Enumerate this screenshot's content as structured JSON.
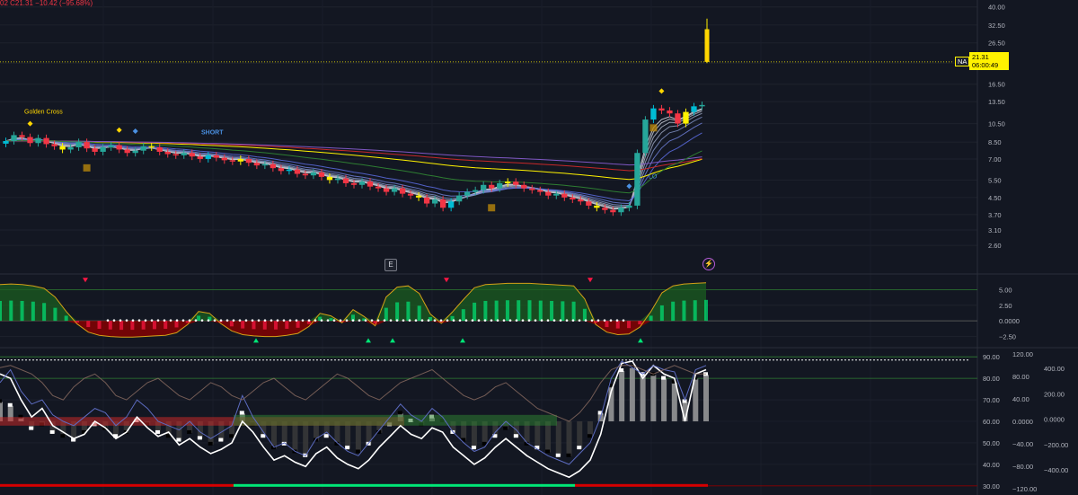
{
  "header": {
    "ohlc_text": "02  C21.31  −10.42 (−95.68%)"
  },
  "price_tag": {
    "symbol": "NA",
    "price": "21.31",
    "countdown": "06:00:49"
  },
  "buttons": {
    "e_label": "E",
    "alert_label": "⚡"
  },
  "colors": {
    "background": "#131722",
    "bull": "#26a69a",
    "bull_alt": "#00bcd4",
    "bear": "#f23645",
    "highlight": "#fff200",
    "grid": "#1e222d",
    "axis_text": "#b2b5be",
    "osc_green": "#00c853",
    "osc_red": "#c62828"
  },
  "chart_data": [
    {
      "type": "candlestick",
      "pane": "price",
      "ytick_labels": [
        "40.00",
        "32.50",
        "26.50",
        "21.00",
        "16.50",
        "13.50",
        "10.50",
        "8.50",
        "7.00",
        "5.50",
        "4.50",
        "3.70",
        "3.10",
        "2.60"
      ],
      "ytick_values": [
        40,
        32.5,
        26.5,
        21,
        16.5,
        13.5,
        10.5,
        8.5,
        7.0,
        5.5,
        4.5,
        3.7,
        3.1,
        2.6
      ],
      "scale": "log",
      "ylim": [
        2.3,
        42
      ],
      "annotations": [
        "Golden Cross",
        "SHORT",
        "LO"
      ],
      "last_price": 21.31,
      "closes": [
        8.6,
        9.2,
        9.0,
        8.4,
        8.9,
        8.3,
        8.1,
        7.8,
        8.0,
        8.5,
        7.9,
        7.6,
        8.0,
        8.2,
        7.8,
        7.5,
        7.7,
        8.1,
        8.0,
        7.6,
        7.4,
        7.3,
        7.5,
        7.2,
        7.0,
        7.3,
        7.1,
        6.9,
        6.8,
        7.0,
        6.7,
        6.5,
        6.6,
        6.3,
        6.1,
        6.2,
        5.9,
        5.8,
        6.0,
        5.7,
        5.5,
        5.6,
        5.3,
        5.2,
        5.4,
        5.1,
        5.0,
        4.8,
        5.0,
        4.7,
        4.6,
        4.5,
        4.2,
        4.4,
        4.0,
        4.3,
        4.6,
        4.8,
        4.9,
        5.2,
        5.0,
        5.3,
        5.4,
        5.2,
        5.0,
        4.9,
        4.8,
        4.6,
        4.7,
        4.5,
        4.4,
        4.3,
        4.1,
        4.0,
        3.9,
        3.8,
        4.0,
        4.1,
        7.5,
        11.0,
        12.5,
        12.2,
        11.8,
        10.5,
        12.0,
        12.8,
        13.0
      ]
    },
    {
      "type": "area",
      "pane": "oscillator-1",
      "ytick_labels": [
        "5.00",
        "2.50",
        "0.0000",
        "−2.50"
      ],
      "ytick_values": [
        5.0,
        2.5,
        0.0,
        -2.5
      ],
      "ylim": [
        -4.0,
        7.5
      ],
      "values": [
        5.8,
        5.9,
        5.8,
        5.6,
        5.2,
        3.8,
        1.5,
        -0.5,
        -1.8,
        -2.3,
        -2.5,
        -2.6,
        -2.6,
        -2.5,
        -2.4,
        -2.3,
        -1.9,
        -0.6,
        1.5,
        1.2,
        -0.4,
        -1.6,
        -2.2,
        -2.4,
        -2.5,
        -2.5,
        -2.3,
        -2.0,
        -0.9,
        1.2,
        0.8,
        -0.3,
        1.8,
        0.7,
        -0.8,
        3.8,
        5.4,
        5.6,
        4.4,
        1.1,
        -0.4,
        1.4,
        3.4,
        5.3,
        5.8,
        5.9,
        6.0,
        6.0,
        6.0,
        5.9,
        5.8,
        5.7,
        5.6,
        3.5,
        -0.6,
        -1.8,
        -2.2,
        -2.1,
        -1.0,
        1.5,
        4.5,
        5.6,
        5.9,
        6.0,
        6.1
      ]
    },
    {
      "type": "line",
      "pane": "oscillator-2",
      "ytick_labels_left": [
        "90.00",
        "80.00",
        "70.00",
        "60.00",
        "50.00",
        "40.00",
        "30.00"
      ],
      "ytick_values_left": [
        90,
        80,
        70,
        60,
        50,
        40,
        30
      ],
      "ytick_labels_mid": [
        "120.00",
        "80.00",
        "40.00",
        "0.0000",
        "−40.00",
        "−80.00",
        "−120.00"
      ],
      "ytick_labels_right": [
        "400.00",
        "200.00",
        "0.0000",
        "−200.00",
        "−400.00"
      ],
      "ylim": [
        27,
        93
      ],
      "series": [
        {
          "values": [
            82,
            80,
            70,
            62,
            66,
            58,
            55,
            52,
            54,
            60,
            57,
            52,
            55,
            62,
            57,
            53,
            55,
            49,
            52,
            48,
            45,
            47,
            50,
            60,
            55,
            48,
            42,
            44,
            41,
            39,
            45,
            48,
            43,
            40,
            38,
            42,
            48,
            53,
            58,
            54,
            52,
            57,
            55,
            48,
            44,
            40,
            43,
            48,
            52,
            48,
            44,
            41,
            38,
            36,
            34,
            37,
            42,
            54,
            74,
            87,
            88,
            80,
            86,
            82,
            80,
            60,
            82,
            84
          ]
        },
        {
          "values": [
            78,
            84,
            74,
            68,
            70,
            63,
            60,
            58,
            62,
            66,
            64,
            58,
            62,
            70,
            66,
            60,
            58,
            56,
            60,
            55,
            52,
            55,
            58,
            72,
            62,
            55,
            48,
            50,
            46,
            44,
            52,
            55,
            50,
            46,
            44,
            50,
            56,
            62,
            68,
            63,
            60,
            66,
            62,
            55,
            50,
            46,
            48,
            55,
            60,
            56,
            50,
            47,
            44,
            42,
            40,
            45,
            50,
            62,
            80,
            88,
            85,
            82,
            86,
            84,
            83,
            70,
            84,
            86
          ]
        },
        {
          "values": [
            85,
            86,
            84,
            82,
            78,
            72,
            70,
            76,
            80,
            82,
            78,
            72,
            70,
            74,
            78,
            80,
            76,
            72,
            70,
            74,
            78,
            76,
            72,
            70,
            74,
            78,
            80,
            76,
            72,
            70,
            74,
            78,
            82,
            80,
            76,
            72,
            70,
            74,
            78,
            80,
            82,
            84,
            80,
            76,
            72,
            70,
            72,
            76,
            78,
            74,
            70,
            66,
            64,
            62,
            60,
            64,
            70,
            78,
            84,
            86,
            86,
            84,
            82,
            84,
            86,
            84,
            82,
            82
          ]
        }
      ],
      "histogram": [
        10,
        8,
        2,
        -4,
        -2,
        -6,
        -8,
        -10,
        -6,
        -2,
        -4,
        -8,
        -6,
        0,
        -2,
        -6,
        -8,
        -10,
        -6,
        -9,
        -12,
        -10,
        -8,
        4,
        -2,
        -8,
        -14,
        -12,
        -16,
        -18,
        -10,
        -8,
        -12,
        -14,
        -16,
        -12,
        -6,
        -2,
        4,
        0,
        -2,
        2,
        0,
        -6,
        -10,
        -14,
        -12,
        -8,
        -4,
        -8,
        -12,
        -14,
        -16,
        -18,
        -18,
        -14,
        -8,
        4,
        18,
        26,
        28,
        24,
        24,
        22,
        20,
        10,
        22,
        24
      ]
    }
  ]
}
